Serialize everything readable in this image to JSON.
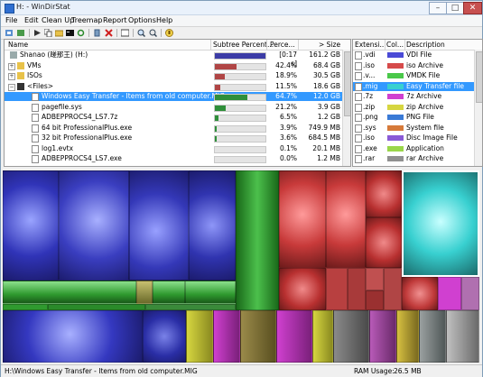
{
  "window": {
    "title": "H: - WinDirStat",
    "minimize": "–",
    "maximize": "□",
    "close": "✕"
  },
  "menu": [
    "File",
    "Edit",
    "Clean Up",
    "Treemap",
    "Report",
    "Options",
    "Help"
  ],
  "toolbar_icons": [
    "refresh-all-icon",
    "refresh-selected-icon",
    "open-item-icon",
    "copy-path-icon",
    "explorer-here-icon",
    "command-prompt-icon",
    "refresh-icon",
    "delete-to-recycle-icon",
    "delete-icon",
    "select-folder-icon",
    "zoom-in-icon",
    "zoom-out-icon",
    "help-icon"
  ],
  "directory": {
    "columns": [
      "Name",
      "Subtree Percent...",
      "Perce...",
      "> Size"
    ],
    "rows": [
      {
        "name": "Shanao (蹉那王) (H:)",
        "pct": "[0:17 s]",
        "size": "161.2 GB",
        "fill": 1.0,
        "color": "#3c3ca6"
      },
      {
        "name": "VMs",
        "pct": "42.4%",
        "size": "68.4 GB",
        "fill": 0.424,
        "color": "#b04545"
      },
      {
        "name": "ISOs",
        "pct": "18.9%",
        "size": "30.5 GB",
        "fill": 0.189,
        "color": "#b04545"
      },
      {
        "name": "<Files>",
        "pct": "11.5%",
        "size": "18.6 GB",
        "fill": 0.115,
        "color": "#b04545"
      },
      {
        "name": "Windows Easy Transfer - Items from old computer.MIG",
        "pct": "64.7%",
        "size": "12.0 GB",
        "fill": 0.647,
        "color": "#2f8f3a"
      },
      {
        "name": "pagefile.sys",
        "pct": "21.2%",
        "size": "3.9 GB",
        "fill": 0.212,
        "color": "#2f8f3a"
      },
      {
        "name": "ADBEPPROCS4_LS7.7z",
        "pct": "6.5%",
        "size": "1.2 GB",
        "fill": 0.065,
        "color": "#2f8f3a"
      },
      {
        "name": "64 bit ProfessionalPlus.exe",
        "pct": "3.9%",
        "size": "749.9 MB",
        "fill": 0.039,
        "color": "#2f8f3a"
      },
      {
        "name": "32 bit ProfessionalPlus.exe",
        "pct": "3.6%",
        "size": "684.5 MB",
        "fill": 0.036,
        "color": "#2f8f3a"
      },
      {
        "name": "log1.evtx",
        "pct": "0.1%",
        "size": "20.1 MB",
        "fill": 0.001,
        "color": "#2f8f3a"
      },
      {
        "name": "ADBEPPROCS4_LS7.exe",
        "pct": "0.0%",
        "size": "1.2 MB",
        "fill": 0.0,
        "color": "#2f8f3a"
      }
    ]
  },
  "extensions": {
    "columns": [
      "Extensi...",
      "Col...",
      "Description"
    ],
    "rows": [
      {
        "ext": ".vdi",
        "color": "#4a4ad6",
        "desc": "VDI File"
      },
      {
        "ext": ".iso",
        "color": "#d64a4a",
        "desc": "iso Archive"
      },
      {
        "ext": ".v...",
        "color": "#4ac84a",
        "desc": "VMDK File"
      },
      {
        "ext": ".mig",
        "color": "#38d0d0",
        "desc": "Easy Transfer file"
      },
      {
        "ext": ".7z",
        "color": "#d040d0",
        "desc": "7z Archive"
      },
      {
        "ext": ".zip",
        "color": "#d6d640",
        "desc": "zip Archive"
      },
      {
        "ext": ".png",
        "color": "#3a7ad6",
        "desc": "PNG File"
      },
      {
        "ext": ".sys",
        "color": "#d67a3a",
        "desc": "System file"
      },
      {
        "ext": ".iso",
        "color": "#8a5ad6",
        "desc": "Disc Image File"
      },
      {
        "ext": ".exe",
        "color": "#9ad64a",
        "desc": "Application"
      },
      {
        "ext": ".rar",
        "color": "#909090",
        "desc": "rar Archive"
      }
    ]
  },
  "status": {
    "path": "H:\\Windows Easy Transfer - Items from old computer.MIG",
    "ram_label": "RAM Usage:",
    "ram_value": "26.5 MB"
  }
}
